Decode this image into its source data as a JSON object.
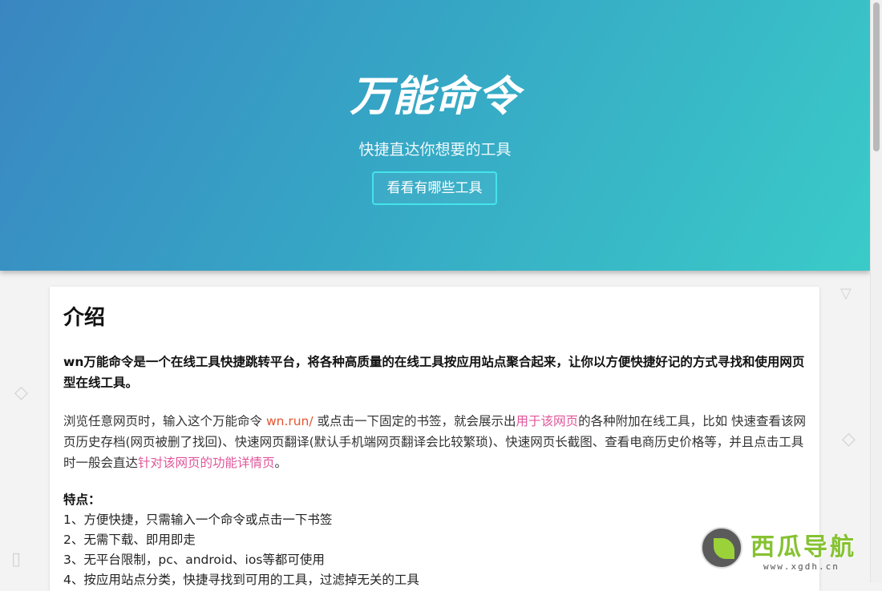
{
  "hero": {
    "title": "万能命令",
    "subtitle": "快捷直达你想要的工具",
    "button_label": "看看有哪些工具"
  },
  "intro": {
    "heading": "介绍",
    "lead": "wn万能命令是一个在线工具快捷跳转平台，将各种高质量的在线工具按应用站点聚合起来，让你以方便快捷好记的方式寻找和使用网页型在线工具。",
    "para_part1": "浏览任意网页时，输入这个万能命令 ",
    "para_link1": "wn.run/",
    "para_part2": " 或点击一下固定的书签，就会展示出",
    "para_link2": "用于该网页",
    "para_part3": "的各种附加在线工具，比如 快速查看该网页历史存档(网页被删了找回)、快速网页翻译(默认手机端网页翻译会比较繁琐)、快速网页长截图、查看电商历史价格等，并且点击工具时一般会直达",
    "para_link3": "针对该网页的功能详情页",
    "para_part4": "。",
    "features_title": "特点：",
    "features": [
      "1、方便快捷，只需输入一个命令或点击一下书签",
      "2、无需下载、即用即走",
      "3、无平台限制，pc、android、ios等都可使用",
      "4、按应用站点分类，快捷寻找到可用的工具，过滤掉无关的工具"
    ]
  },
  "watermark": {
    "name": "西瓜导航",
    "url": "www.xgdh.cn"
  },
  "colors": {
    "hero_start": "#3a86c2",
    "hero_end": "#3acbc8",
    "link_red": "#e4552f",
    "link_pink": "#e0569a",
    "button_border": "#46e3ea"
  }
}
